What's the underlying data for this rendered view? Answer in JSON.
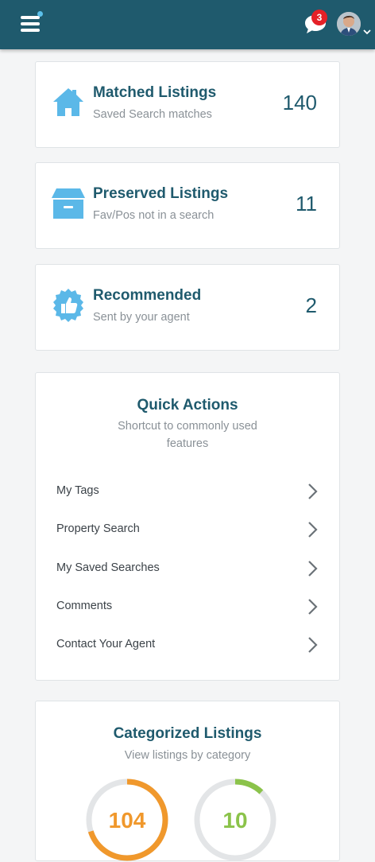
{
  "header": {
    "notification_count": "3",
    "menu_icon": "hamburger-menu-icon",
    "chat_icon": "chat-bubble-icon",
    "accent_color": "#1f5a6d"
  },
  "stats": [
    {
      "title": "Matched Listings",
      "subtitle": "Saved Search matches",
      "count": "140",
      "icon": "house-icon"
    },
    {
      "title": "Preserved Listings",
      "subtitle": "Fav/Pos not in a search",
      "count": "11",
      "icon": "archive-box-icon"
    },
    {
      "title": "Recommended",
      "subtitle": "Sent by your agent",
      "count": "2",
      "icon": "thumbs-up-badge-icon"
    }
  ],
  "quick_actions": {
    "title": "Quick Actions",
    "subtitle": "Shortcut to commonly used features",
    "items": [
      {
        "label": "My Tags"
      },
      {
        "label": "Property Search"
      },
      {
        "label": "My Saved Searches"
      },
      {
        "label": "Comments"
      },
      {
        "label": "Contact Your Agent"
      }
    ]
  },
  "categorized": {
    "title": "Categorized Listings",
    "subtitle": "View listings by category",
    "rings": [
      {
        "color": "#f0982c",
        "fraction": 0.7,
        "label": "104"
      },
      {
        "color": "#8bc34a",
        "fraction": 0.12,
        "label": "10"
      }
    ]
  }
}
